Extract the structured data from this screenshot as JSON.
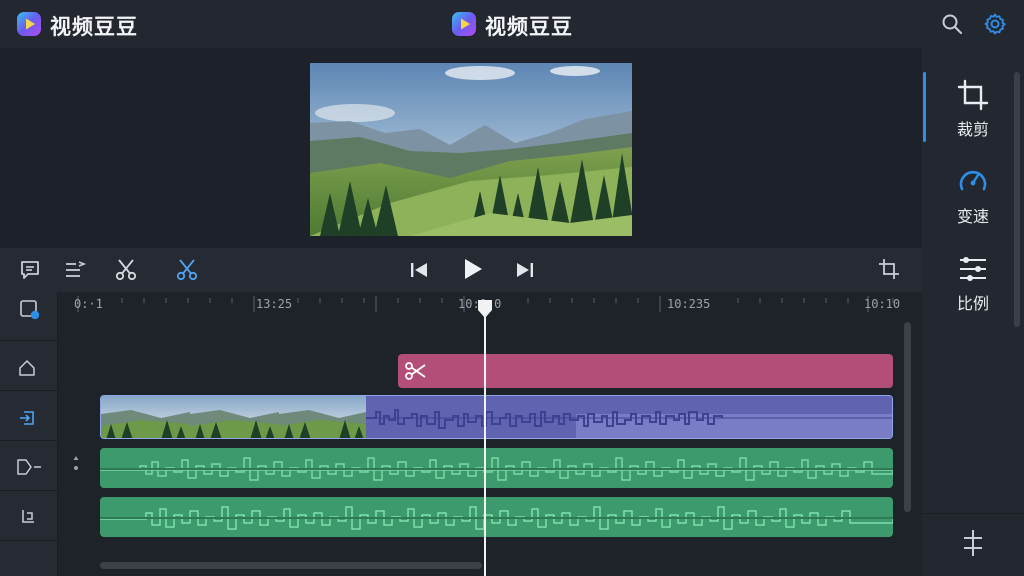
{
  "app": {
    "title_left": "视频豆豆",
    "title_center": "视频豆豆"
  },
  "header": {
    "search_icon": "search-icon",
    "settings_icon": "gear-icon"
  },
  "side_tools": [
    {
      "label": "裁剪",
      "icon": "crop-icon",
      "active": true
    },
    {
      "label": "变速",
      "icon": "speed-gauge-icon",
      "active": false
    },
    {
      "label": "比例",
      "icon": "sliders-icon",
      "active": false
    }
  ],
  "timeline": {
    "ruler_labels": [
      "0:·1",
      "13:25",
      "10:0.0",
      "10:235",
      "10:10"
    ]
  },
  "colors": {
    "accent": "#2f8ee8",
    "clip_pink": "#b24e77",
    "clip_video": "#5f63b0",
    "clip_audio": "#3d9a6d"
  }
}
